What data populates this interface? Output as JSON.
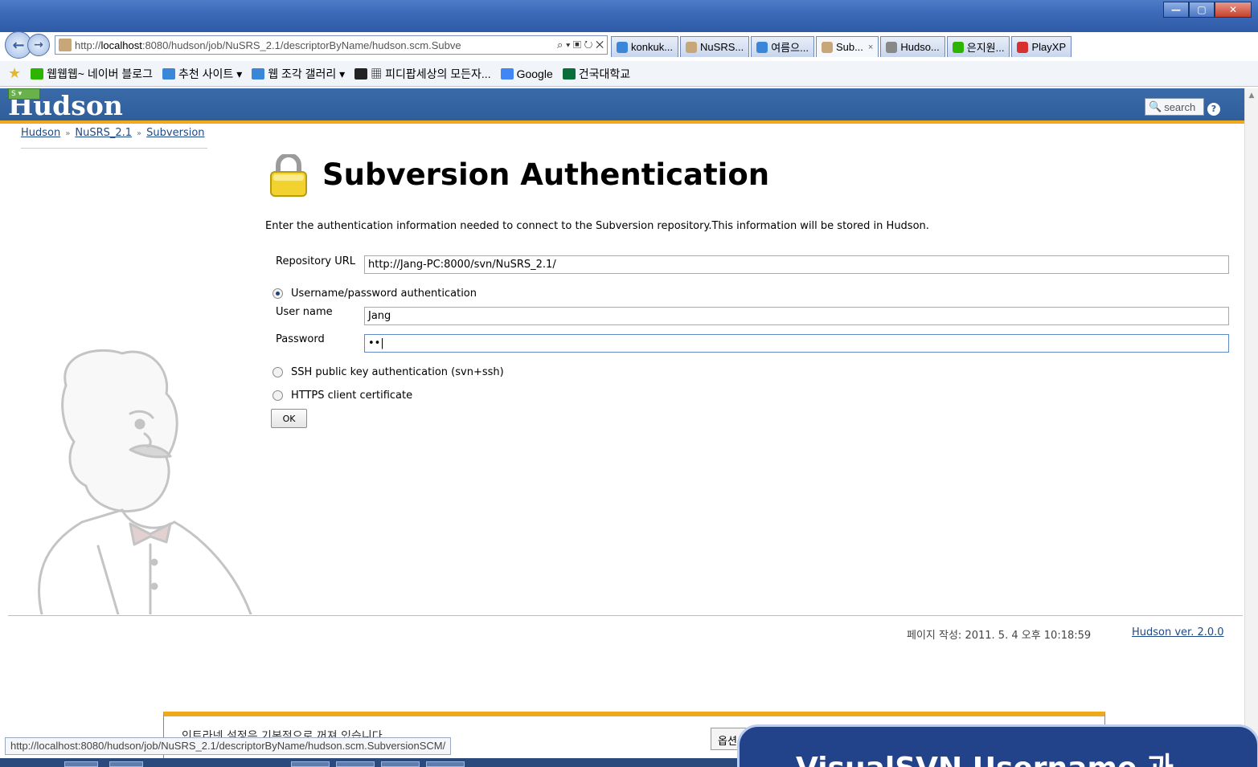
{
  "browser": {
    "address_prefix": "http://",
    "address_host": "localhost",
    "address_rest": ":8080/hudson/job/NuSRS_2.1/descriptorByName/hudson.scm.Subve",
    "address_tools": "⌕ ▾ ▣ ↻ ✕",
    "tabs": [
      {
        "label": "konkuk...",
        "icon": "ie-icon",
        "color": "#3a86d8",
        "active": false
      },
      {
        "label": "NuSRS...",
        "icon": "hudson-icon",
        "color": "#c7a678",
        "active": false
      },
      {
        "label": "여름으...",
        "icon": "ie-icon",
        "color": "#3a86d8",
        "active": false
      },
      {
        "label": "Sub...",
        "icon": "hudson-icon",
        "color": "#c7a678",
        "active": true,
        "close": "×"
      },
      {
        "label": "Hudso...",
        "icon": "hudson-face-icon",
        "color": "#888888",
        "active": false
      },
      {
        "label": "은지원...",
        "icon": "naver-blog-icon",
        "color": "#2db400",
        "active": false
      },
      {
        "label": "PlayXP",
        "icon": "playxp-icon",
        "color": "#d63030",
        "active": false
      }
    ],
    "window_controls": {
      "minimize": "—",
      "maximize": "▢",
      "close": "✕"
    },
    "right_icons": {
      "home": "⌂",
      "favorites": "★",
      "tools": "⚙"
    }
  },
  "favorites_bar": {
    "items": [
      {
        "label": "웹웹웹~ 네이버 블로그",
        "icon": "naver-blog-icon",
        "color": "#2db400"
      },
      {
        "label": "추천 사이트 ▾",
        "icon": "ie-icon",
        "color": "#3a86d8"
      },
      {
        "label": "웹 조각 갤러리 ▾",
        "icon": "web-slice-icon",
        "color": "#3a86d8"
      },
      {
        "label": "▦ 피디팝세상의 모든자...",
        "icon": "tv-icon",
        "color": "#222222"
      },
      {
        "label": "Google",
        "icon": "google-icon",
        "color": "#4285f4"
      },
      {
        "label": "건국대학교",
        "icon": "ku-icon",
        "color": "#0a6e3a"
      }
    ]
  },
  "hudson": {
    "logo": "Hudson",
    "logo_badge": "S ▾",
    "search_placeholder": "search",
    "help": "?",
    "breadcrumb": [
      {
        "label": "Hudson"
      },
      {
        "label": "NuSRS_2.1"
      },
      {
        "label": "Subversion"
      }
    ],
    "breadcrumb_separator": "»",
    "title": "Subversion Authentication",
    "intro": "Enter the authentication information needed to connect to the Subversion repository.This information will be stored in Hudson.",
    "repo_url_label": "Repository URL",
    "repo_url_value": "http://Jang-PC:8000/svn/NuSRS_2.1/",
    "auth_options": [
      {
        "label": "Username/password authentication",
        "checked": true
      },
      {
        "label": "SSH public key authentication (svn+ssh)",
        "checked": false
      },
      {
        "label": "HTTPS client certificate",
        "checked": false
      }
    ],
    "username_label": "User name",
    "username_value": "Jang",
    "password_label": "Password",
    "password_value": "••|",
    "ok_button": "OK",
    "footer_date": "페이지 작성: 2011. 5. 4 오후 10:18:59",
    "footer_version": "Hudson ver. 2.0.0"
  },
  "overlays": {
    "notify_text": "인트라넷 설정은 기본적으로 꺼져 있습니다.",
    "notify_button": "옵션",
    "status_url": "http://localhost:8080/hudson/job/NuSRS_2.1/descriptorByName/hudson.scm.SubversionSCM/",
    "caption": "VisualSVN Username 과"
  }
}
